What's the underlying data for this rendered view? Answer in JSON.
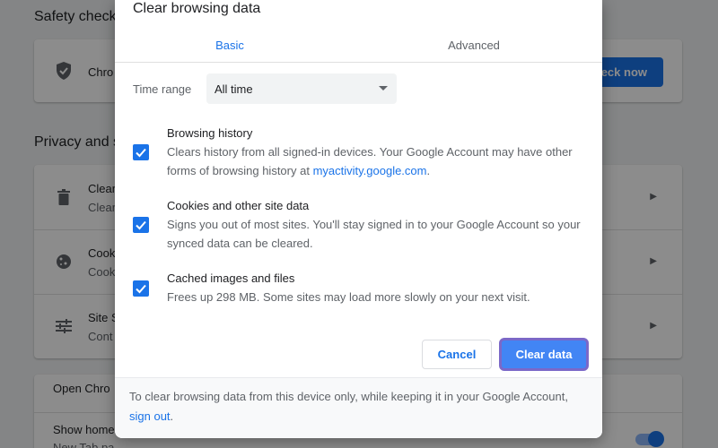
{
  "background": {
    "safety_check": {
      "heading": "Safety check",
      "row_text": "Chro",
      "button_label": "eck now"
    },
    "privacy": {
      "heading": "Privacy and s",
      "rows": [
        {
          "title": "Clear",
          "subtitle": "Clear",
          "icon": "trash-icon"
        },
        {
          "title": "Cook",
          "subtitle": "Cook",
          "icon": "cookie-icon"
        },
        {
          "title": "Site S",
          "subtitle": "Cont",
          "icon": "tune-icon"
        }
      ]
    },
    "appearance": {
      "row1": "Open Chro",
      "row2": "Show home",
      "row3": "New Tab pa"
    }
  },
  "dialog": {
    "title": "Clear browsing data",
    "tabs": [
      {
        "label": "Basic",
        "active": true
      },
      {
        "label": "Advanced",
        "active": false
      }
    ],
    "time_range": {
      "label": "Time range",
      "value": "All time"
    },
    "options": [
      {
        "title": "Browsing history",
        "desc": "Clears history from all signed-in devices. Your Google Account may have other forms of browsing history at ",
        "link": "myactivity.google.com",
        "desc_suffix": ".",
        "checked": true
      },
      {
        "title": "Cookies and other site data",
        "desc": "Signs you out of most sites. You'll stay signed in to your Google Account so your synced data can be cleared.",
        "checked": true
      },
      {
        "title": "Cached images and files",
        "desc": "Frees up 298 MB. Some sites may load more slowly on your next visit.",
        "checked": true
      }
    ],
    "cancel_label": "Cancel",
    "clear_label": "Clear data",
    "footer": {
      "text": "To clear browsing data from this device only, while keeping it in your Google Account, ",
      "link": "sign out",
      "suffix": "."
    }
  },
  "colors": {
    "accent": "#1a73e8",
    "clear_button": "#4285f4",
    "focus_ring": "#7b68c8"
  }
}
